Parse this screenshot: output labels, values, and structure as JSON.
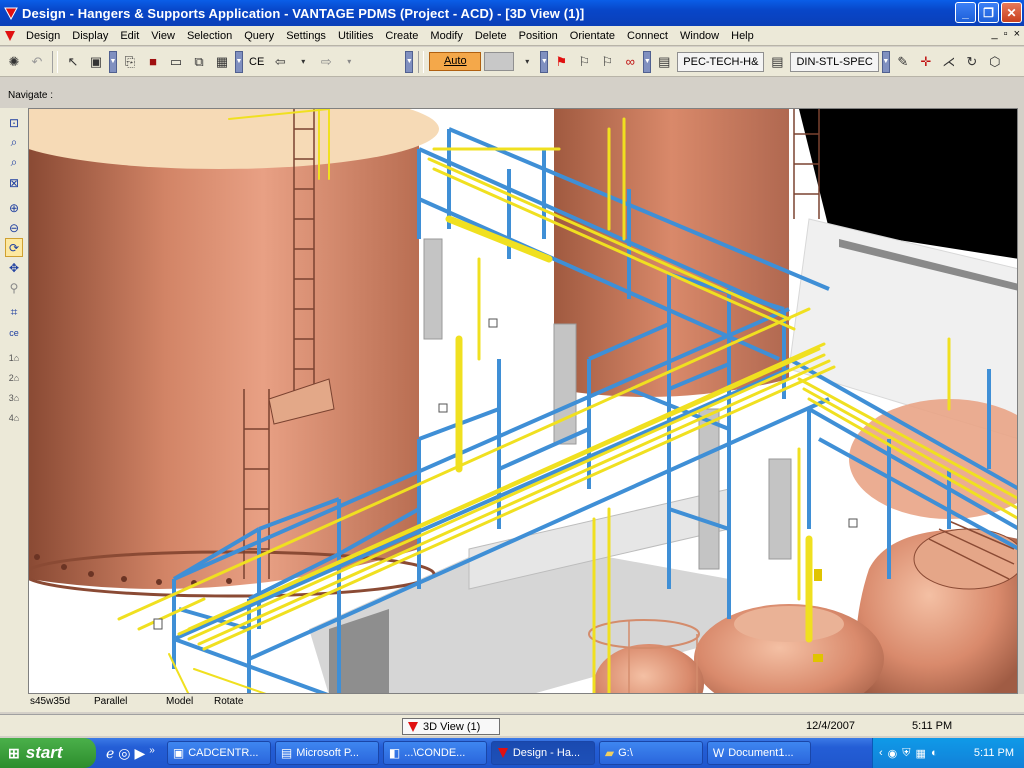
{
  "window": {
    "title": "Design - Hangers & Supports Application - VANTAGE PDMS (Project - ACD) - [3D View (1)]",
    "min_icon": "minimize-icon",
    "max_icon": "maximize-icon",
    "close_icon": "close-icon"
  },
  "menu": {
    "items": [
      "Design",
      "Display",
      "Edit",
      "View",
      "Selection",
      "Query",
      "Settings",
      "Utilities",
      "Create",
      "Modify",
      "Delete",
      "Position",
      "Orientate",
      "Connect",
      "Window",
      "Help"
    ],
    "right_controls": [
      "_",
      "▫",
      "×"
    ]
  },
  "toolbar": {
    "ce_label": "CE",
    "auto_label": "Auto",
    "spec1": "PEC-TECH-H&",
    "spec2": "DIN-STL-SPEC"
  },
  "navigate_label": "Navigate :",
  "status": {
    "direction": "s45w35d",
    "projection": "Parallel",
    "mode": "Model",
    "action": "Rotate"
  },
  "docbar": {
    "view_tab": "3D View (1)",
    "date": "12/4/2007",
    "time": "5:11 PM"
  },
  "taskbar": {
    "start_label": "start",
    "tasks": [
      "CADCENTR...",
      "Microsoft P...",
      "...\\CONDE...",
      "Design - Ha...",
      "G:\\",
      "Document1..."
    ],
    "tray_time": "5:11 PM"
  },
  "colors": {
    "tank": "#d98a68",
    "tank_top": "#f6d8b4",
    "steel": "#3f8fd6",
    "pipe": "#f0e020",
    "concrete": "#c8c8c8",
    "title_bar": "#0a46c8",
    "taskbar": "#245ed6"
  }
}
